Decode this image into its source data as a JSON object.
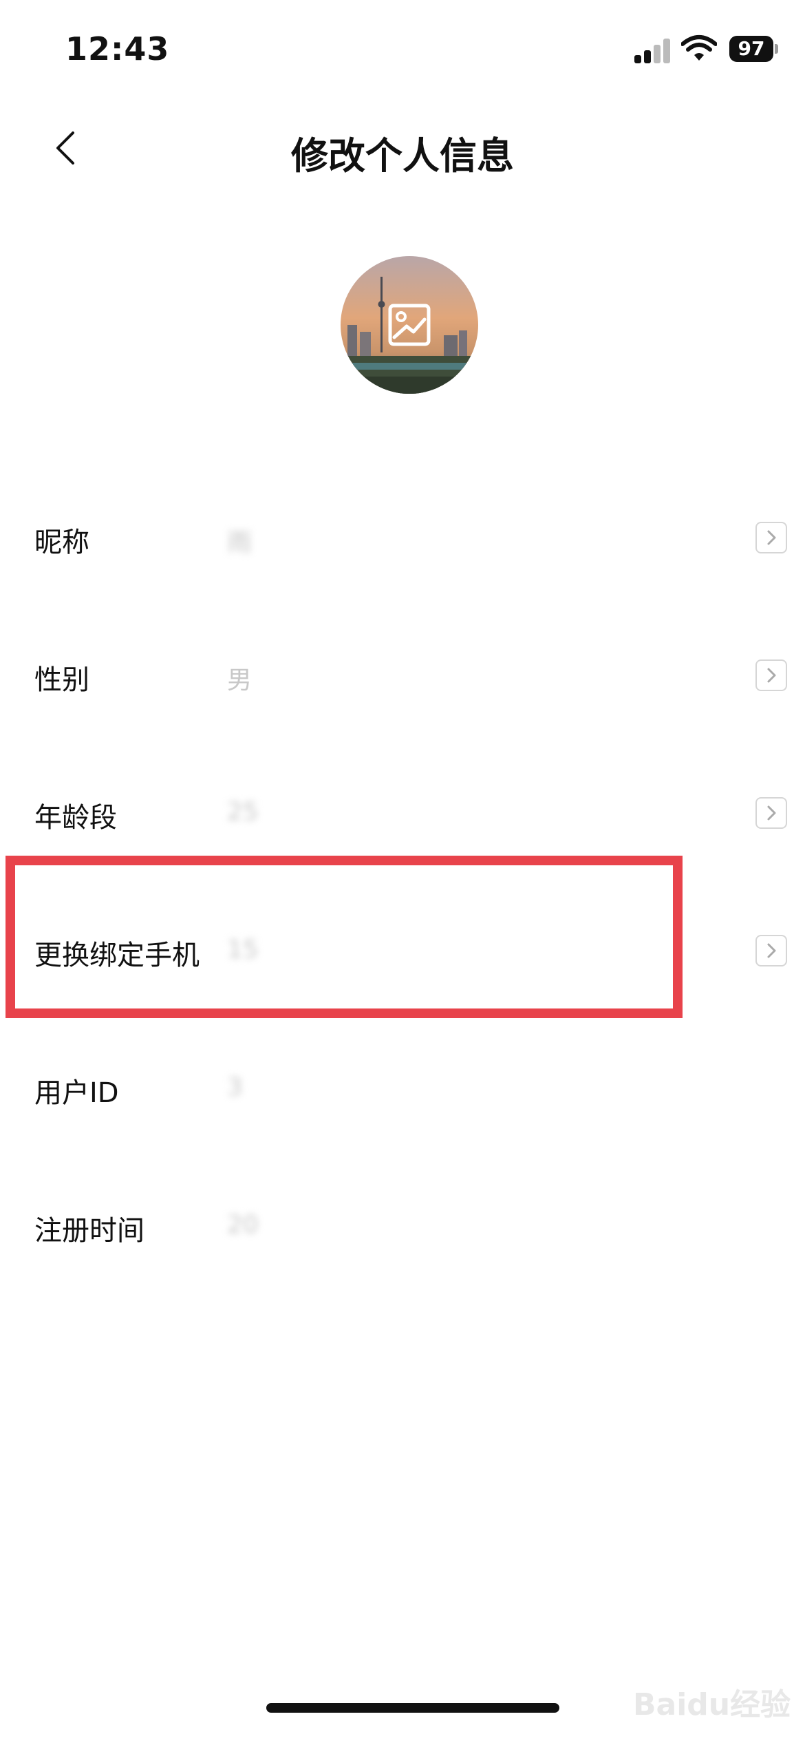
{
  "status_bar": {
    "time": "12:43",
    "battery": "97",
    "icons": [
      "signal-icon",
      "wifi-icon",
      "battery-icon"
    ]
  },
  "header": {
    "title": "修改个人信息",
    "back_icon": "chevron-left-icon"
  },
  "profile": {
    "avatar_icon": "image-icon"
  },
  "rows": [
    {
      "label": "昵称",
      "value": "雨",
      "has_arrow": true
    },
    {
      "label": "性别",
      "value": "男",
      "has_arrow": true
    },
    {
      "label": "年龄段",
      "value": "25",
      "has_arrow": true
    },
    {
      "label": "更换绑定手机",
      "value": "15",
      "has_arrow": true
    },
    {
      "label": "用户ID",
      "value": "3",
      "has_arrow": false
    },
    {
      "label": "注册时间",
      "value": "20",
      "has_arrow": false
    }
  ],
  "colors": {
    "highlight": "#e8434b",
    "value_text": "#c8c8c8"
  },
  "watermark": "Baidu经验"
}
